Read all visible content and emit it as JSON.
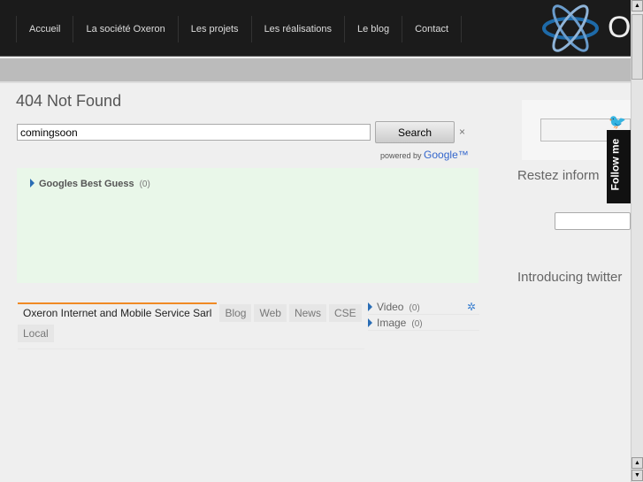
{
  "nav": [
    "Accueil",
    "La société Oxeron",
    "Les projets",
    "Les réalisations",
    "Le blog",
    "Contact"
  ],
  "logo": {
    "letter": "O"
  },
  "page_title": "404 Not Found",
  "search": {
    "value": "comingsoon",
    "button": "Search",
    "clear": "×",
    "powered_by": "powered by",
    "google": "Google™"
  },
  "best_guess": {
    "label": "Googles Best Guess",
    "count": "(0)"
  },
  "tabs": [
    "Oxeron Internet and Mobile Service Sarl",
    "Blog",
    "Web",
    "News",
    "CSE",
    "Local"
  ],
  "side_results": [
    {
      "label": "Video",
      "count": "(0)"
    },
    {
      "label": "Image",
      "count": "(0)"
    }
  ],
  "sidebar": {
    "heading1": "Restez inform",
    "heading2": "Introducing twitter",
    "follow": "Follow me"
  }
}
